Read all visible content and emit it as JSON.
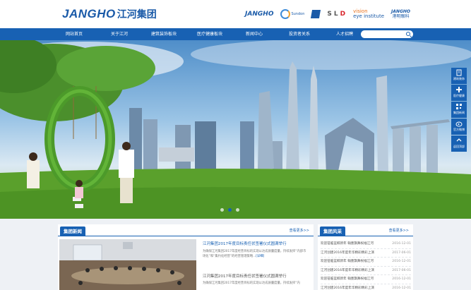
{
  "header": {
    "logo_en": "JANGHO",
    "logo_cn": "江河集团",
    "brands": {
      "jangho": "JANGHO",
      "sundon": "Sundon",
      "sld_s": "S",
      "sld_l": "L",
      "sld_d": "D",
      "vision_top": "vision",
      "vision_bottom": "eye institute",
      "hk_en": "JANGHO",
      "hk_cn": "港明眼科"
    }
  },
  "nav": {
    "items": [
      "网站首页",
      "关于江河",
      "建筑装饰板块",
      "医疗健康板块",
      "新闻中心",
      "投资者关系",
      "人才招聘"
    ],
    "search_placeholder": ""
  },
  "sidebar": {
    "items": [
      "建筑装饰",
      "医疗健康",
      "集团新闻",
      "官方微博",
      "返回顶部"
    ]
  },
  "news": {
    "tab": "集团新闻",
    "more": "查看更多>>",
    "articles": [
      {
        "title": "江河集团2017年度目标责任状签署仪式圆满举行",
        "summary": "为确保江河集团2017年度经营目标的实现以达成质量度量，持续发挥“内部市场化”和“集约化经营”的经营管理策略...",
        "detail": "[详细]"
      },
      {
        "title": "江河集团2017年度目标责任状签署仪式圆满举行",
        "summary": "为确保江河集团2017年度经营目标的实现以达成质量度量，持续发挥“内",
        "detail": ""
      }
    ]
  },
  "style": {
    "tab": "集团风采",
    "more": "查看更多>>",
    "rows": [
      {
        "title": "欢迎莅临蓝鲸新年 翰墨飘舞祝福江河",
        "date": "2016-12-01"
      },
      {
        "title": "江河创建2016年度年华精彩精彩上演",
        "date": "2017-06-01"
      },
      {
        "title": "欢迎莅临蓝鲸新年 翰墨飘舞祝福江河",
        "date": "2016-12-01"
      },
      {
        "title": "江河创建2016年度年华精彩精彩上演",
        "date": "2017-06-01"
      },
      {
        "title": "欢迎莅临蓝鲸新年 翰墨飘舞祝福江河",
        "date": "2016-12-01"
      },
      {
        "title": "江河创建2016年度年华精彩精彩上演",
        "date": "2016-12-01"
      }
    ]
  },
  "colors": {
    "brand_blue": "#1861b3",
    "grass": "#5aa02c"
  },
  "banner": {
    "slide_count": 3,
    "active_slide": 2
  }
}
